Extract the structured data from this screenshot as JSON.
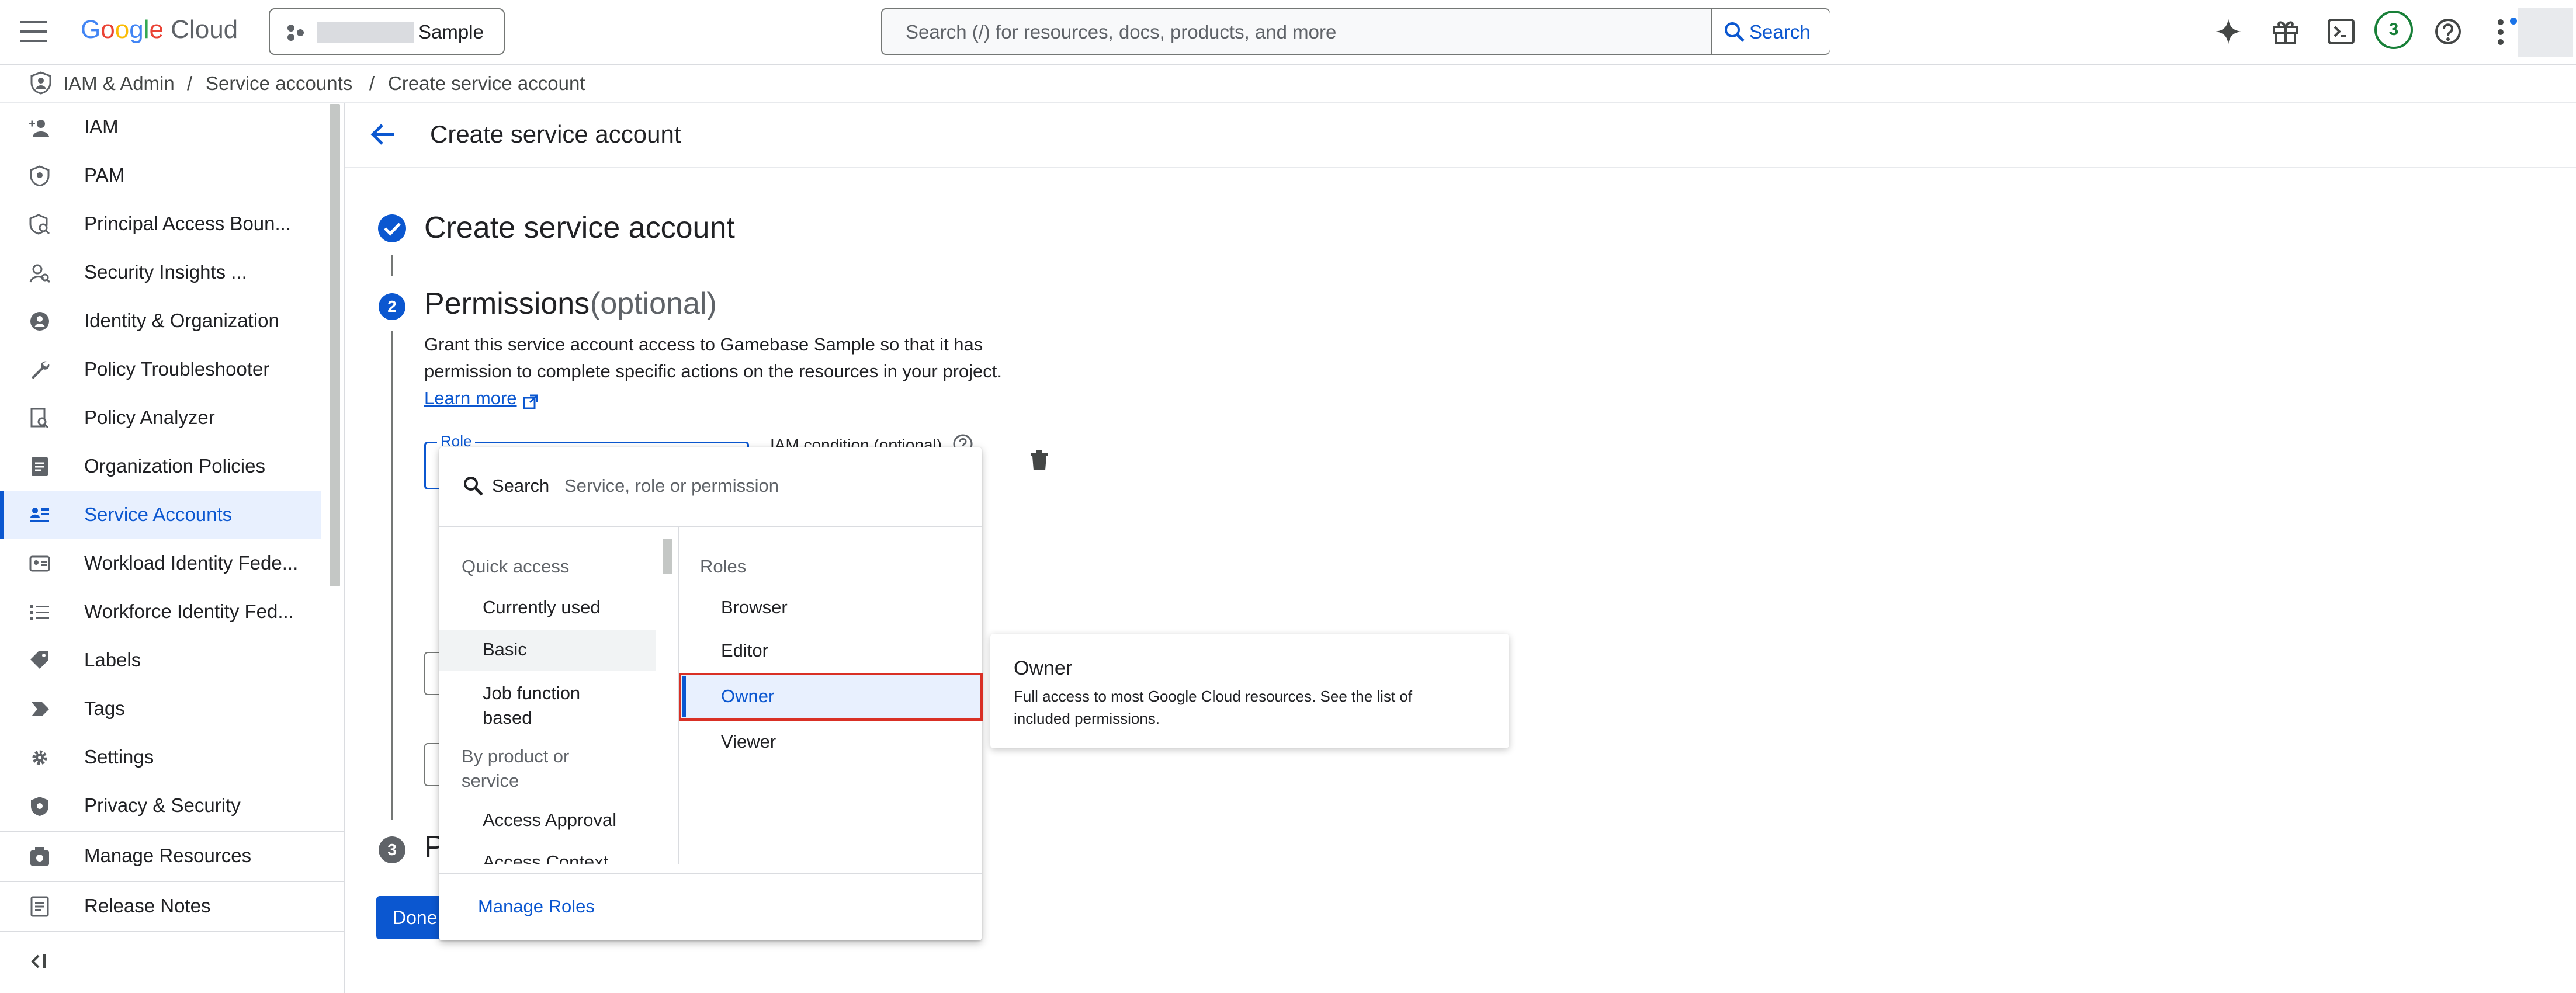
{
  "header": {
    "logo_text": "Google Cloud",
    "project_name": "Sample",
    "search_placeholder": "Search (/) for resources, docs, products, and more",
    "search_button": "Search",
    "notification_count": "3"
  },
  "breadcrumb": [
    "IAM & Admin",
    "Service accounts",
    "Create service account"
  ],
  "sidebar": {
    "items": [
      {
        "label": "IAM",
        "icon": "person-add-icon"
      },
      {
        "label": "PAM",
        "icon": "shield-icon"
      },
      {
        "label": "Principal Access Boun...",
        "icon": "shield-search-icon"
      },
      {
        "label": "Security Insights ...",
        "icon": "person-search-icon"
      },
      {
        "label": "Identity & Organization",
        "icon": "account-circle-icon"
      },
      {
        "label": "Policy Troubleshooter",
        "icon": "wrench-icon"
      },
      {
        "label": "Policy Analyzer",
        "icon": "document-search-icon"
      },
      {
        "label": "Organization Policies",
        "icon": "list-document-icon"
      },
      {
        "label": "Service Accounts",
        "icon": "service-account-icon"
      },
      {
        "label": "Workload Identity Fede...",
        "icon": "id-card-icon"
      },
      {
        "label": "Workforce Identity Fed...",
        "icon": "list-icon"
      },
      {
        "label": "Labels",
        "icon": "label-icon"
      },
      {
        "label": "Tags",
        "icon": "tag-arrow-icon"
      },
      {
        "label": "Settings",
        "icon": "gear-icon"
      },
      {
        "label": "Privacy & Security",
        "icon": "shield-gear-icon"
      }
    ],
    "active_index": 8,
    "bottom_items": [
      {
        "label": "Manage Resources",
        "icon": "manage-resources-icon"
      },
      {
        "label": "Release Notes",
        "icon": "release-notes-icon"
      }
    ]
  },
  "page": {
    "title": "Create service account",
    "step1_title": "Create service account",
    "step2_number": "2",
    "step2_title": "Permissions",
    "step2_optional": "(optional)",
    "step2_desc_line1": "Grant this service account access to Gamebase Sample so that it has",
    "step2_desc_line2": "permission to complete specific actions on the resources in your project.",
    "learn_more": "Learn more",
    "role_label": "Role",
    "iam_condition_label": "IAM condition (optional)",
    "step3_number": "3",
    "step3_partial": "P",
    "done_partial": "Done"
  },
  "dropdown": {
    "search_label": "Search",
    "search_placeholder": "Service, role or permission",
    "left_header": "Quick access",
    "left_items": [
      "Currently used",
      "Basic",
      "Job function based"
    ],
    "left_selected": "Basic",
    "left_header2": "By product or service",
    "left_items2": [
      "Access Approval",
      "Access Context"
    ],
    "right_header": "Roles",
    "right_items": [
      "Browser",
      "Editor",
      "Owner",
      "Viewer"
    ],
    "right_selected": "Owner",
    "manage_roles": "Manage Roles"
  },
  "tooltip": {
    "title": "Owner",
    "line1": "Full access to most Google Cloud resources. See the list of",
    "line2": "included permissions."
  },
  "colors": {
    "accent": "#1a73e8",
    "highlight_border": "#d93025",
    "selected_bg": "#e8f0fe"
  }
}
